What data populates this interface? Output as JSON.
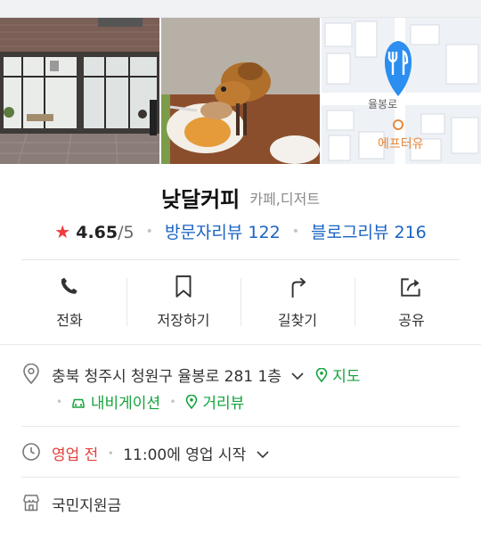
{
  "place": {
    "name": "낮달커피",
    "category": "카페,디저트",
    "rating": "4.65",
    "rating_max": "/5",
    "visitor_reviews": "방문자리뷰 122",
    "blog_reviews": "블로그리뷰 216"
  },
  "map_photo": {
    "street_label": "율봉로",
    "poi_label": "에프터유"
  },
  "actions": [
    {
      "label": "전화",
      "icon": "phone-icon"
    },
    {
      "label": "저장하기",
      "icon": "bookmark-icon"
    },
    {
      "label": "길찾기",
      "icon": "directions-icon"
    },
    {
      "label": "공유",
      "icon": "share-icon"
    }
  ],
  "address": {
    "text": "충북 청주시 청원구 율봉로 281 1층",
    "map_link": "지도",
    "navigation_link": "내비게이션",
    "street_view_link": "거리뷰"
  },
  "hours": {
    "status": "영업 전",
    "detail": "11:00에 영업 시작"
  },
  "support": {
    "text": "국민지원금"
  },
  "colors": {
    "accent_blue": "#1a63c4",
    "accent_green": "#15a33d",
    "status_red": "#e0413b",
    "star_red": "#ef3b3b",
    "map_pin_blue": "#2b8ef0"
  }
}
